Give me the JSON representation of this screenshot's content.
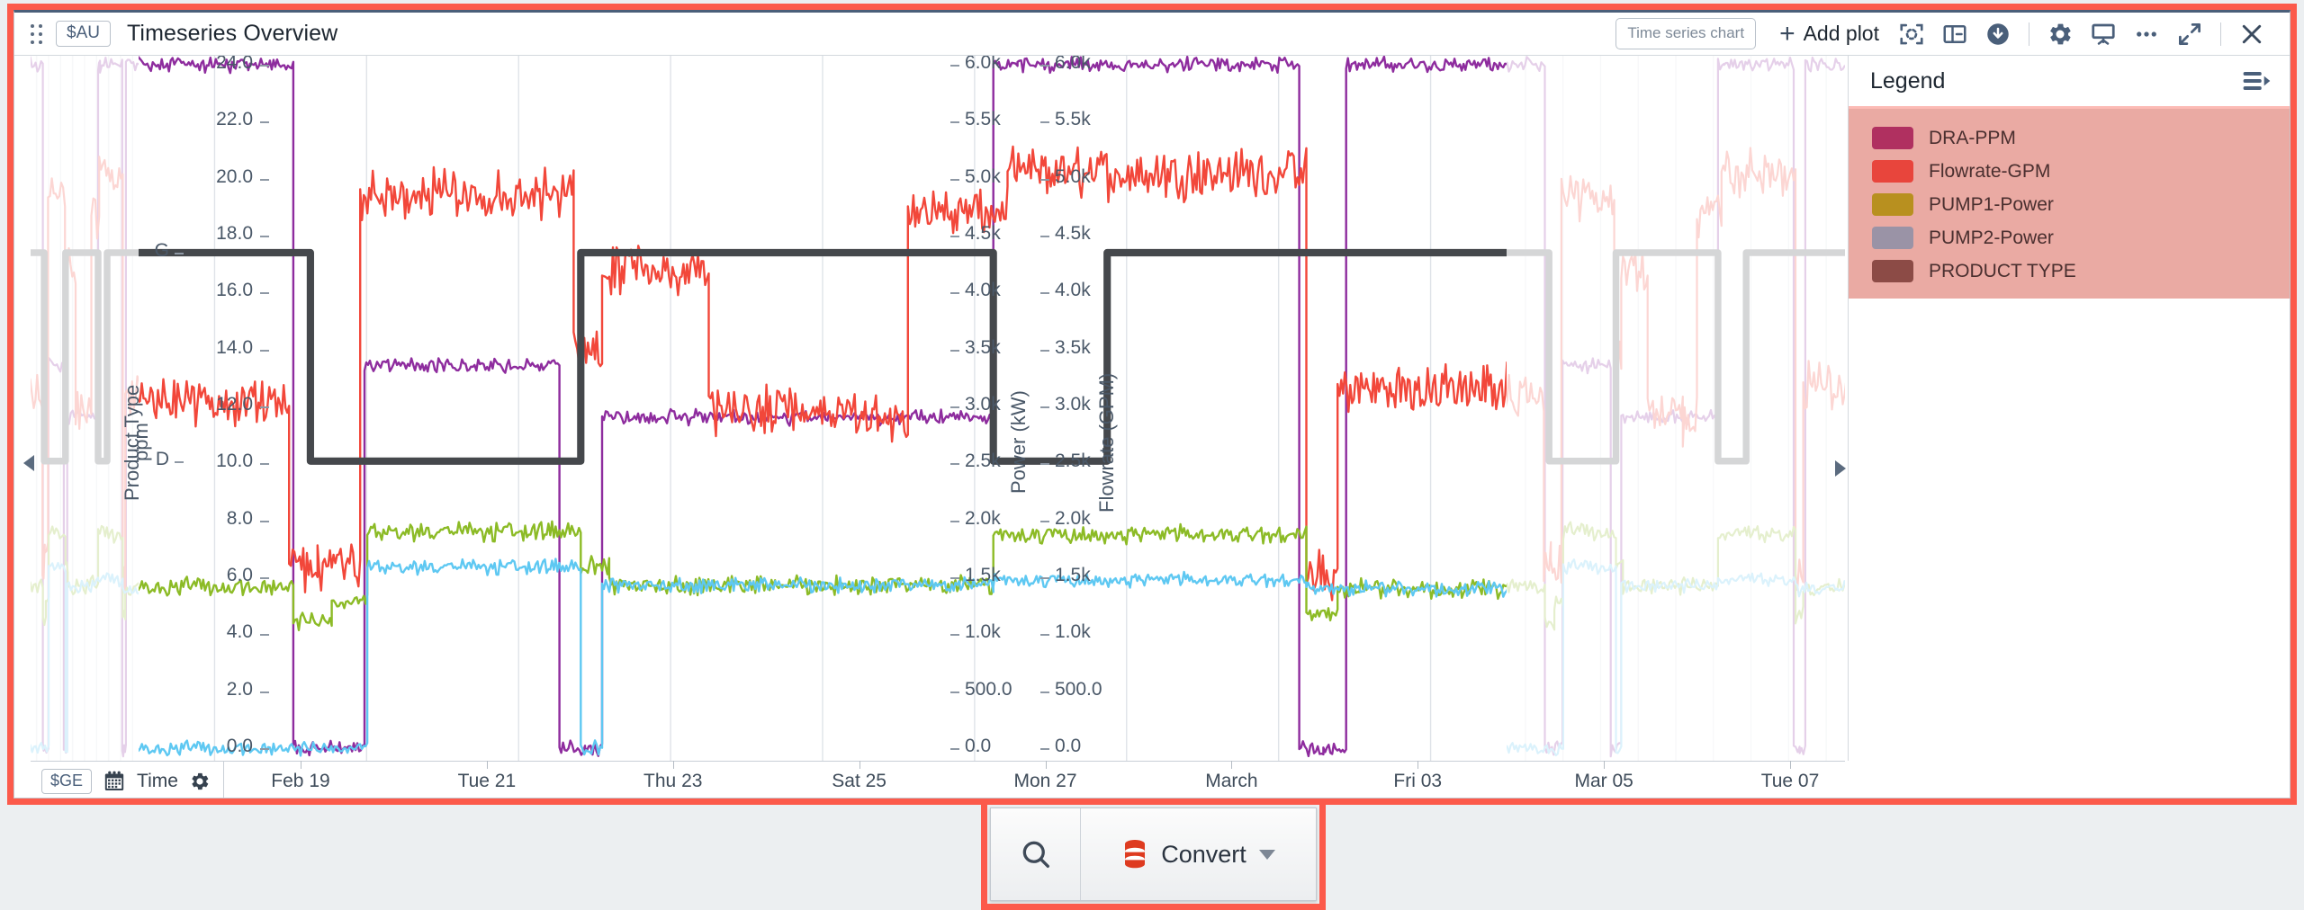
{
  "header": {
    "drag_handle_icon": "drag-dots-icon",
    "scope_badge": "$AU",
    "title": "Timeseries Overview",
    "chart_type_pill": "Time series chart",
    "add_plot_label": "Add plot",
    "icons": [
      "crop-focus-icon",
      "split-panel-icon",
      "download-circle-icon",
      "gear-icon",
      "presentation-icon",
      "more-horizontal-icon",
      "fullscreen-expand-icon",
      "close-icon"
    ]
  },
  "x_axis": {
    "scope_badge": "$GE",
    "calendar_icon": "calendar-icon",
    "label": "Time",
    "gear_icon": "gear-icon",
    "ticks": [
      "Feb 19",
      "Tue 21",
      "Thu 23",
      "Sat 25",
      "Mon 27",
      "March",
      "Fri 03",
      "Mar 05",
      "Tue 07"
    ]
  },
  "legend": {
    "title": "Legend",
    "collapse_icon": "list-collapse-icon",
    "items": [
      {
        "label": "DRA-PPM",
        "color": "#b03060"
      },
      {
        "label": "Flowrate-GPM",
        "color": "#e8453c"
      },
      {
        "label": "PUMP1-Power",
        "color": "#b8901f"
      },
      {
        "label": "PUMP2-Power",
        "color": "#9a93a6"
      },
      {
        "label": "PRODUCT TYPE",
        "color": "#8c4b46"
      }
    ]
  },
  "convert_toolbar": {
    "search_icon": "search-icon",
    "database_icon": "database-icon",
    "label": "Convert",
    "caret_icon": "chevron-down-icon"
  },
  "nav": {
    "left_arrow_icon": "arrow-left-icon",
    "right_arrow_icon": "arrow-right-icon"
  },
  "chart_data": {
    "type": "line",
    "title": "Timeseries Overview",
    "xlabel": "Time",
    "grid": true,
    "legend_position": "right",
    "x_tick_labels": [
      "Feb 19",
      "Tue 21",
      "Thu 23",
      "Sat 25",
      "Mon 27",
      "March",
      "Fri 03",
      "Mar 05",
      "Tue 07"
    ],
    "axes": [
      {
        "id": "ppm",
        "name": "ppm",
        "side": "left",
        "ylim": [
          0.0,
          25.0
        ],
        "ticks": [
          "0.0",
          "2.0",
          "4.0",
          "6.0",
          "8.0",
          "10.0",
          "12.0",
          "14.0",
          "16.0",
          "18.0",
          "20.0",
          "22.0",
          "24.0"
        ]
      },
      {
        "id": "product-type",
        "name": "Product Type",
        "side": "left",
        "categories": [
          "D",
          "G"
        ]
      },
      {
        "id": "power",
        "name": "Power (kW)",
        "side": "right",
        "ylim": [
          0.0,
          6000.0
        ],
        "ticks": [
          "0.0",
          "500.0",
          "1.0k",
          "1.5k",
          "2.0k",
          "2.5k",
          "3.0k",
          "3.5k",
          "4.0k",
          "4.5k",
          "5.0k",
          "5.5k",
          "6.0k"
        ]
      },
      {
        "id": "flowrate",
        "name": "Flowrate (GPM)",
        "side": "right",
        "ylim": [
          0.0,
          6000.0
        ],
        "ticks": [
          "0.0",
          "500.0",
          "1.0k",
          "1.5k",
          "2.0k",
          "2.5k",
          "3.0k",
          "3.5k",
          "4.0k",
          "4.5k",
          "5.0k",
          "5.5k",
          "6.0k"
        ]
      }
    ],
    "series": [
      {
        "name": "DRA-PPM",
        "color": "#8e2c9e",
        "axis": "ppm",
        "unit": "ppm",
        "noise": 0.32,
        "segments": [
          {
            "x0": 0.0,
            "x1": 0.128,
            "value": 25.0
          },
          {
            "x0": 0.128,
            "x1": 0.143,
            "value": 0.0
          },
          {
            "x0": 0.143,
            "x1": 0.178,
            "value": 0.0
          },
          {
            "x0": 0.178,
            "x1": 0.315,
            "value": 14.0
          },
          {
            "x0": 0.315,
            "x1": 0.333,
            "value": 0.0
          },
          {
            "x0": 0.333,
            "x1": 0.345,
            "value": 0.0
          },
          {
            "x0": 0.345,
            "x1": 0.62,
            "value": 12.1
          },
          {
            "x0": 0.62,
            "x1": 0.637,
            "value": 25.0
          },
          {
            "x0": 0.637,
            "x1": 0.835,
            "value": 25.0
          },
          {
            "x0": 0.835,
            "x1": 0.852,
            "value": 0.0
          },
          {
            "x0": 0.852,
            "x1": 0.868,
            "value": 0.0
          },
          {
            "x0": 0.868,
            "x1": 1.0,
            "value": 25.0
          }
        ]
      },
      {
        "name": "Flowrate-GPM",
        "color": "#f2473a",
        "axis": "flowrate",
        "unit": "GPM",
        "noise": 260,
        "segments": [
          {
            "x0": 0.0,
            "x1": 0.125,
            "value": 3050
          },
          {
            "x0": 0.125,
            "x1": 0.145,
            "value": 1620
          },
          {
            "x0": 0.145,
            "x1": 0.175,
            "value": 1600
          },
          {
            "x0": 0.175,
            "x1": 0.325,
            "value": 4850
          },
          {
            "x0": 0.325,
            "x1": 0.345,
            "value": 3500
          },
          {
            "x0": 0.345,
            "x1": 0.42,
            "value": 4200
          },
          {
            "x0": 0.42,
            "x1": 0.52,
            "value": 2950
          },
          {
            "x0": 0.52,
            "x1": 0.56,
            "value": 2900
          },
          {
            "x0": 0.56,
            "x1": 0.63,
            "value": 4700
          },
          {
            "x0": 0.63,
            "x1": 0.84,
            "value": 5050
          },
          {
            "x0": 0.84,
            "x1": 0.862,
            "value": 1500
          },
          {
            "x0": 0.862,
            "x1": 1.0,
            "value": 3150
          }
        ]
      },
      {
        "name": "PUMP1-Power",
        "color": "#8cbb26",
        "axis": "power",
        "unit": "kW",
        "noise": 95,
        "segments": [
          {
            "x0": 0.0,
            "x1": 0.128,
            "value": 1420
          },
          {
            "x0": 0.128,
            "x1": 0.155,
            "value": 1120
          },
          {
            "x0": 0.155,
            "x1": 0.18,
            "value": 1280
          },
          {
            "x0": 0.18,
            "x1": 0.33,
            "value": 1900
          },
          {
            "x0": 0.33,
            "x1": 0.35,
            "value": 1600
          },
          {
            "x0": 0.35,
            "x1": 0.62,
            "value": 1430
          },
          {
            "x0": 0.62,
            "x1": 0.84,
            "value": 1880
          },
          {
            "x0": 0.84,
            "x1": 0.862,
            "value": 1180
          },
          {
            "x0": 0.862,
            "x1": 1.0,
            "value": 1400
          }
        ]
      },
      {
        "name": "PUMP2-Power",
        "color": "#5ec8f2",
        "axis": "power",
        "unit": "kW",
        "noise": 75,
        "segments": [
          {
            "x0": 0.0,
            "x1": 0.18,
            "value": 0
          },
          {
            "x0": 0.18,
            "x1": 0.33,
            "value": 1590
          },
          {
            "x0": 0.33,
            "x1": 0.345,
            "value": 0
          },
          {
            "x0": 0.345,
            "x1": 0.62,
            "value": 1430
          },
          {
            "x0": 0.62,
            "x1": 0.84,
            "value": 1480
          },
          {
            "x0": 0.84,
            "x1": 1.0,
            "value": 1400
          }
        ]
      },
      {
        "name": "PRODUCT TYPE",
        "color": "#45484c",
        "axis": "product-type",
        "step": true,
        "noise": 0,
        "segments": [
          {
            "x0": 0.0,
            "x1": 0.14,
            "category": "G"
          },
          {
            "x0": 0.14,
            "x1": 0.33,
            "category": "D"
          },
          {
            "x0": 0.33,
            "x1": 0.62,
            "category": "G"
          },
          {
            "x0": 0.62,
            "x1": 0.7,
            "category": "D"
          },
          {
            "x0": 0.7,
            "x1": 1.0,
            "category": "G"
          }
        ]
      }
    ]
  }
}
